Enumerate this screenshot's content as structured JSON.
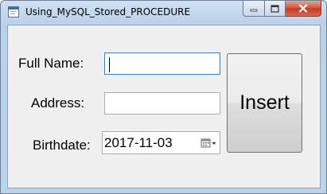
{
  "window": {
    "title": "Using_MySQL_Stored_PROCEDURE",
    "icons": {
      "app": "form-icon",
      "minimize": "minimize-icon",
      "maximize": "maximize-icon",
      "close": "close-icon"
    }
  },
  "form": {
    "full_name_label": "Full Name:",
    "full_name_value": "",
    "address_label": "Address:",
    "address_value": "",
    "birthdate_label": "Birthdate:",
    "birthdate_value": "2017-11-03",
    "calendar_icon": "calendar-dropdown-icon",
    "insert_label": "Insert"
  }
}
